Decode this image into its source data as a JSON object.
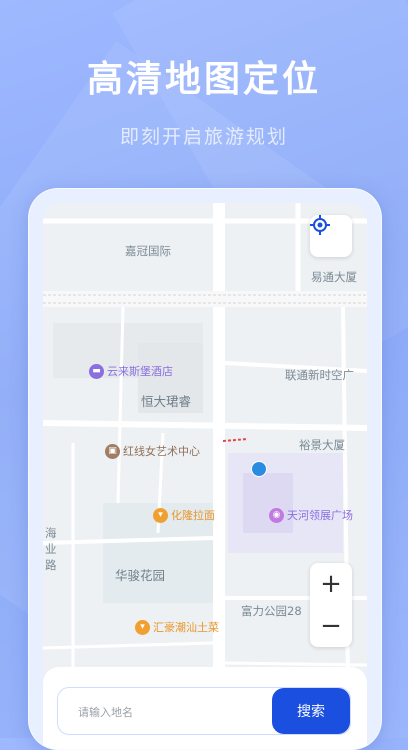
{
  "header": {
    "title": "高清地图定位",
    "subtitle": "即刻开启旅游规划"
  },
  "map": {
    "labels": {
      "jiaguan": "嘉冠国际",
      "yitong": "易通大厦",
      "lianhong": "联通新时空广",
      "hengda": "恒大珺睿",
      "yujing": "裕景大厦",
      "huajun": "华骏花园",
      "fuli": "富力公园28",
      "haiye": "海\n业\n路"
    },
    "pois": {
      "hotel": "云来斯堡酒店",
      "art": "红线女艺术中心",
      "ramen": "化隆拉面",
      "tianhe": "天河领展广场",
      "chaoshan": "汇豪潮汕土菜"
    }
  },
  "colors": {
    "accent": "#1a4fe0",
    "poi_purple": "#8b6ee0",
    "poi_brown": "#a07d64",
    "poi_orange": "#f0a030"
  },
  "controls": {
    "zoom_in": "+",
    "zoom_out": "−"
  },
  "search": {
    "placeholder": "请输入地名",
    "button_label": "搜索"
  }
}
